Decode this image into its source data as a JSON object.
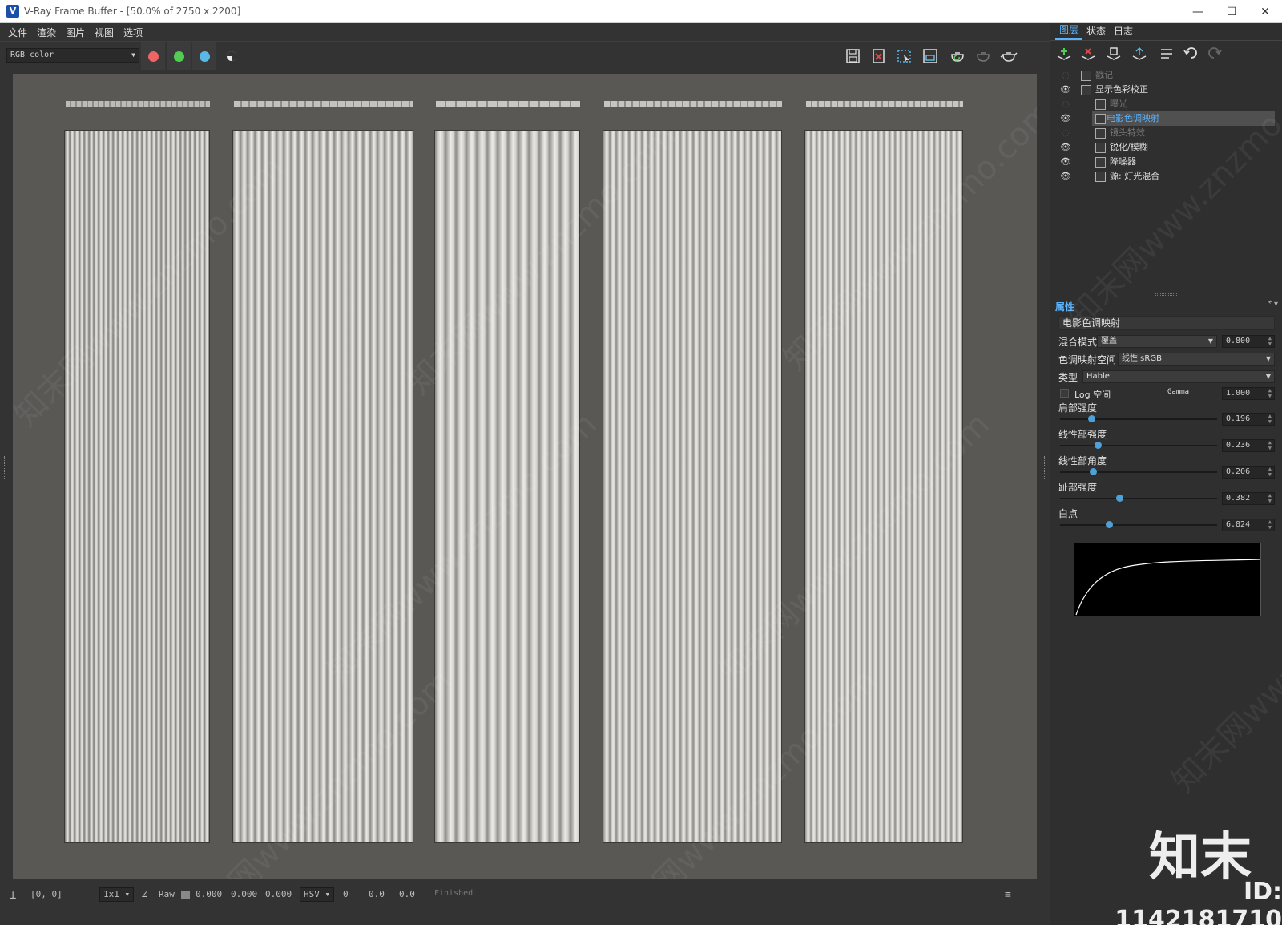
{
  "window": {
    "title": "V-Ray Frame Buffer - [50.0% of 2750 x 2200]",
    "app_icon_letter": "V",
    "minimize": "—",
    "maximize": "☐",
    "close": "✕"
  },
  "menu": [
    "文件",
    "渲染",
    "图片",
    "视图",
    "选项"
  ],
  "toolbar": {
    "channel": "RGB color",
    "colors": {
      "red": "#f06464",
      "green": "#52cc52",
      "blue": "#5ab8e6",
      "toggle": "#ffffff"
    }
  },
  "right_tabs": [
    "图层",
    "状态",
    "日志"
  ],
  "layers": [
    {
      "label": "戳记",
      "visible": false,
      "dim": true,
      "indent": 0
    },
    {
      "label": "显示色彩校正",
      "visible": true,
      "dim": false,
      "indent": 0
    },
    {
      "label": "曝光",
      "visible": false,
      "dim": true,
      "indent": 1
    },
    {
      "label": "电影色调映射",
      "visible": true,
      "dim": false,
      "indent": 1,
      "selected": true
    },
    {
      "label": "镜头特效",
      "visible": false,
      "dim": true,
      "indent": 1
    },
    {
      "label": "锐化/模糊",
      "visible": true,
      "dim": false,
      "indent": 1
    },
    {
      "label": "降噪器",
      "visible": true,
      "dim": false,
      "indent": 1
    },
    {
      "label": "源: 灯光混合",
      "visible": true,
      "dim": false,
      "indent": 1
    }
  ],
  "properties": {
    "header": "属性",
    "pin": "↰▾",
    "layer_name": "电影色调映射",
    "blend_mode_label": "混合模式",
    "blend_mode_value": "覆盖",
    "blend_amount": "0.800",
    "tonemap_space_label": "色调映射空间",
    "tonemap_space_value": "线性 sRGB",
    "type_label": "类型",
    "type_value": "Hable",
    "log_space_label": "Log 空间",
    "gamma_label": "Gamma",
    "gamma_value": "1.000",
    "sliders": [
      {
        "label": "肩部强度",
        "value": "0.196",
        "position": 0.2
      },
      {
        "label": "线性部强度",
        "value": "0.236",
        "position": 0.24
      },
      {
        "label": "线性部角度",
        "value": "0.206",
        "position": 0.21
      },
      {
        "label": "趾部强度",
        "value": "0.382",
        "position": 0.38
      },
      {
        "label": "白点",
        "value": "6.824",
        "position": 0.31
      }
    ]
  },
  "status": {
    "coords": "[0, 0]",
    "zoom": "1x1",
    "raw_label": "Raw",
    "r": "0.000",
    "g": "0.000",
    "b": "0.000",
    "color_space": "HSV",
    "h": "0",
    "s": "0.0",
    "v": "0.0",
    "state": "Finished"
  },
  "watermark": {
    "text": "知末网www.znzmo.com",
    "brand": "知末",
    "id": "ID: 1142181710"
  }
}
